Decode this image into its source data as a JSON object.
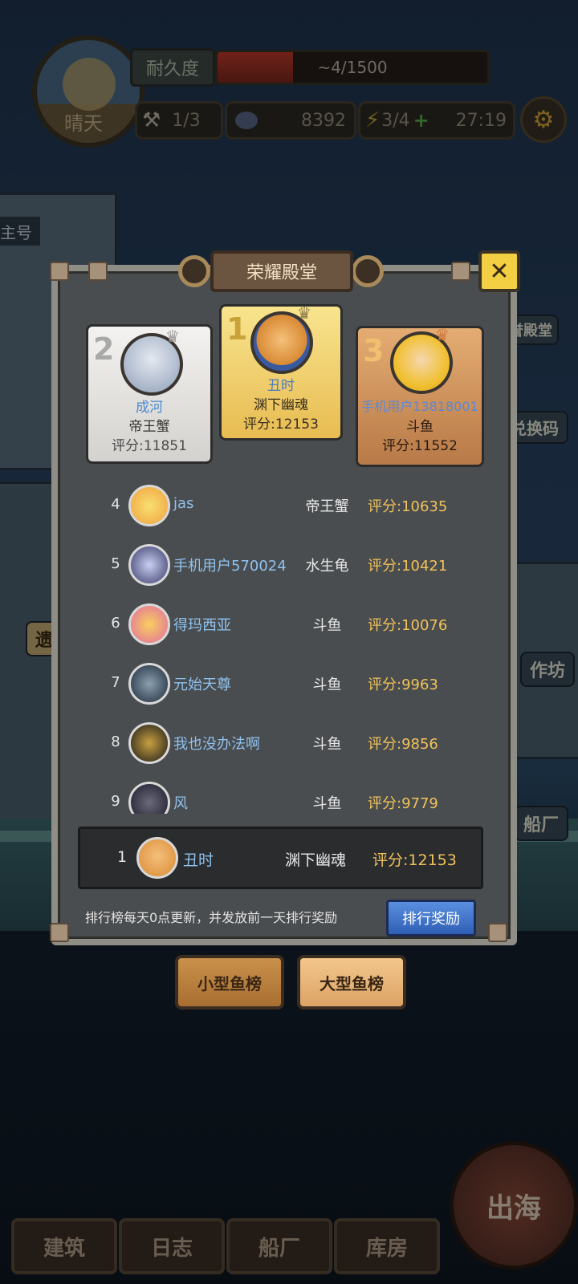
{
  "hud": {
    "weather": "晴天",
    "durability_label": "耐久度",
    "durability_text": "~4/1500",
    "durability_fraction": 0.28,
    "tools": "1/3",
    "coins": "8392",
    "energy": "3/4",
    "timer": "27:19"
  },
  "side": {
    "honor": "誉殿堂",
    "redeem": "兑换码",
    "workshop": "作坊",
    "shipyard": "船厂",
    "left_tag": "遗",
    "left_top": "主号"
  },
  "panel": {
    "title": "荣耀殿堂",
    "close": "✕",
    "podium": [
      {
        "rank": "1",
        "name": "丑时",
        "fish": "渊下幽魂",
        "score": "评分:12153"
      },
      {
        "rank": "2",
        "name": "成河",
        "fish": "帝王蟹",
        "score": "评分:11851"
      },
      {
        "rank": "3",
        "name": "手机用户13818001",
        "fish": "斗鱼",
        "score": "评分:11552"
      }
    ],
    "rows": [
      {
        "no": "4",
        "name": "jas",
        "fish": "帝王蟹",
        "score": "评分:10635"
      },
      {
        "no": "5",
        "name": "手机用户570024",
        "fish": "水生龟",
        "score": "评分:10421"
      },
      {
        "no": "6",
        "name": "得玛西亚",
        "fish": "斗鱼",
        "score": "评分:10076"
      },
      {
        "no": "7",
        "name": "元始天尊",
        "fish": "斗鱼",
        "score": "评分:9963"
      },
      {
        "no": "8",
        "name": "我也没办法啊",
        "fish": "斗鱼",
        "score": "评分:9856"
      },
      {
        "no": "9",
        "name": "风",
        "fish": "斗鱼",
        "score": "评分:9779"
      }
    ],
    "me": {
      "no": "1",
      "name": "丑时",
      "fish": "渊下幽魂",
      "score": "评分:12153"
    },
    "notice": "排行榜每天0点更新，并发放前一天排行奖励",
    "reward_button": "排行奖励"
  },
  "tabs": {
    "small": "小型鱼榜",
    "large": "大型鱼榜"
  },
  "nav": {
    "build": "建筑",
    "log": "日志",
    "shipyard": "船厂",
    "warehouse": "库房",
    "sail": "出海"
  }
}
